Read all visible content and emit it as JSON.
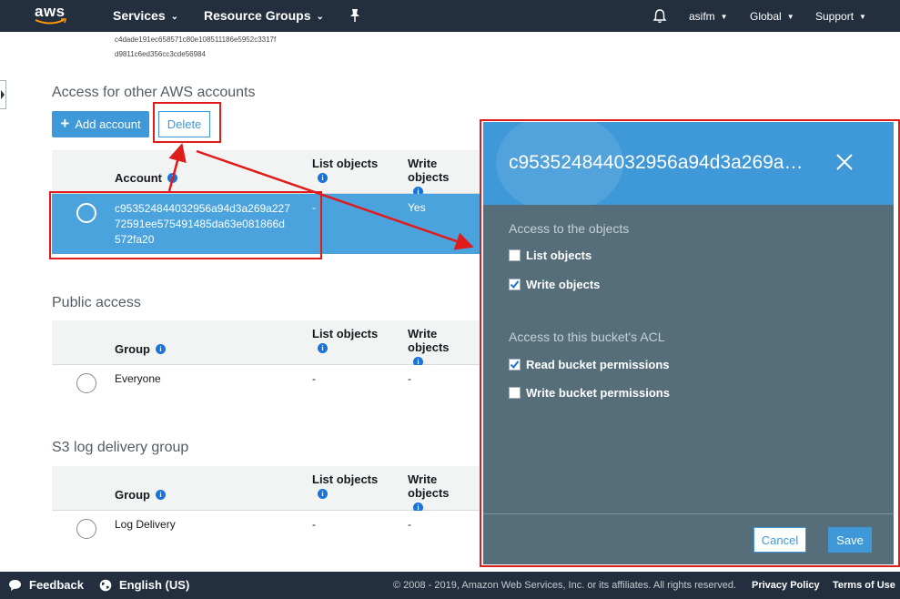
{
  "nav": {
    "logo": "aws",
    "services": "Services",
    "resource_groups": "Resource Groups",
    "user": "asifm",
    "region": "Global",
    "support": "Support"
  },
  "hash_lines": [
    "c4dade191ec658571c80e108511186e5952c3317f",
    "d9811c6ed356cc3cde56984"
  ],
  "accounts_section": {
    "title": "Access for other AWS accounts",
    "add_button": "Add account",
    "delete_button": "Delete",
    "col_account": "Account",
    "col_list": "List objects",
    "col_write": "Write objects",
    "row": {
      "account_line1": "c953524844032956a94d3a269a227",
      "account_line2": "72591ee575491485da63e081866d",
      "account_line3": "572fa20",
      "list": "-",
      "write": "Yes"
    }
  },
  "public_section": {
    "title": "Public access",
    "col_group": "Group",
    "col_list": "List objects",
    "col_write": "Write objects",
    "row": {
      "group": "Everyone",
      "list": "-",
      "write": "-"
    }
  },
  "log_section": {
    "title": "S3 log delivery group",
    "col_group": "Group",
    "col_list": "List objects",
    "col_write": "Write objects",
    "row": {
      "group": "Log Delivery",
      "list": "-",
      "write": "-"
    }
  },
  "panel": {
    "title": "c953524844032956a94d3a269a…",
    "objects_title": "Access to the objects",
    "list_objects": {
      "label": "List objects",
      "checked": false
    },
    "write_objects": {
      "label": "Write objects",
      "checked": true
    },
    "acl_title": "Access to this bucket's ACL",
    "read_perm": {
      "label": "Read bucket permissions",
      "checked": true
    },
    "write_perm": {
      "label": "Write bucket permissions",
      "checked": false
    },
    "cancel": "Cancel",
    "save": "Save"
  },
  "footer": {
    "feedback": "Feedback",
    "language": "English (US)",
    "copyright": "© 2008 - 2019, Amazon Web Services, Inc. or its affiliates. All rights reserved.",
    "privacy": "Privacy Policy",
    "terms": "Terms of Use"
  },
  "colors": {
    "nav_bg": "#232f3e",
    "accent": "#3f98d7",
    "selected_row": "#4aa3dd",
    "panel_bg": "#566e7a",
    "annotation_red": "#e01b1b"
  }
}
